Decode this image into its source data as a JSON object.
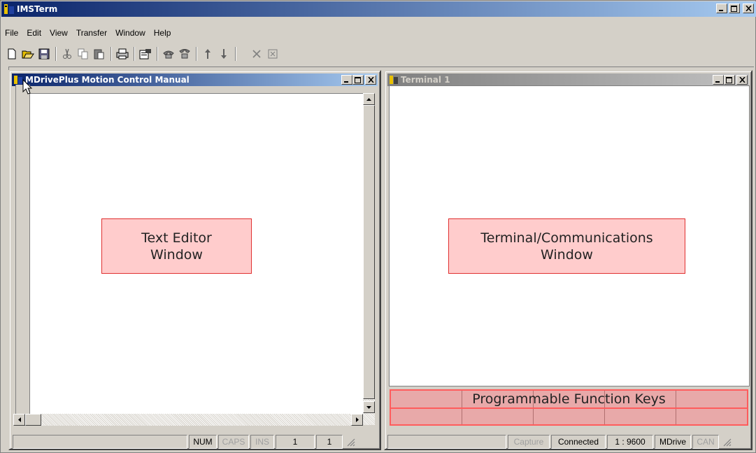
{
  "app": {
    "title": "IMSTerm"
  },
  "menu": [
    "File",
    "Edit",
    "View",
    "Transfer",
    "Window",
    "Help"
  ],
  "toolbar": {
    "groups": [
      [
        "new-icon",
        "open-icon",
        "save-icon"
      ],
      [
        "cut-icon",
        "copy-icon",
        "paste-icon"
      ],
      [
        "print-icon"
      ],
      [
        "properties-icon"
      ],
      [
        "connect-icon",
        "disconnect-icon"
      ],
      [
        "upload-icon",
        "download-icon"
      ],
      [
        "delete-icon",
        "clear-icon"
      ]
    ]
  },
  "editor": {
    "title": "MDrivePlus Motion Control Manual",
    "overlay_line1": "Text Editor",
    "overlay_line2": "Window",
    "status": {
      "num": "NUM",
      "caps": "CAPS",
      "ins": "INS",
      "line": "1",
      "col": "1"
    }
  },
  "terminal": {
    "title": "Terminal 1",
    "overlay_line1": "Terminal/Communications",
    "overlay_line2": "Window",
    "fkeys_label": "Programmable Function Keys",
    "status": {
      "capture": "Capture",
      "connected": "Connected",
      "port": "1 : 9600",
      "device": "MDrive",
      "can": "CAN"
    }
  },
  "colors": {
    "overlay_fill": "#ffcccc",
    "overlay_border": "#e03030",
    "titlebar_active": "#0a246a"
  }
}
